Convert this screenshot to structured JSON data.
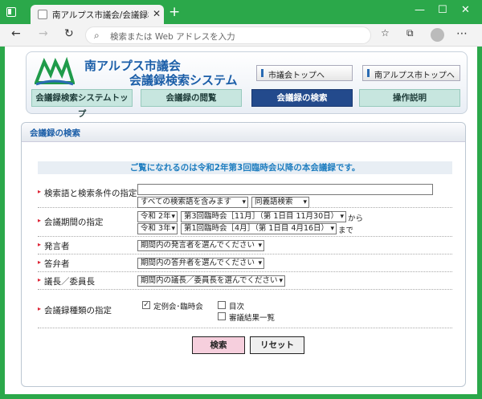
{
  "browser": {
    "tab_title": "南アルプス市議会/会議録検索システム",
    "new_tab": "+",
    "address_placeholder": "検索または Web アドレスを入力",
    "back": "←",
    "forward": "→",
    "refresh": "↻",
    "more": "⋯",
    "minimize": "—",
    "maximize": "☐",
    "close": "✕"
  },
  "header": {
    "site_name_line1": "南アルプス市議会",
    "site_name_line2": "会議録検索システム",
    "link_council_top": "市議会トップへ",
    "link_city_top": "南アルプス市トップへ"
  },
  "nav": {
    "tabs": [
      "会議録検索システムトップ",
      "会議録の閲覧",
      "会議録の検索",
      "操作説明"
    ],
    "active_index": 2
  },
  "search": {
    "section_title": "会議録の検索",
    "notice": "ご覧になれるのは令和2年第3回臨時会以降の本会議録です。",
    "keyword_label": "検索語と検索条件の指定",
    "keyword_value": "",
    "keyword_condition": "すべての検索語を含みます",
    "synonym_option": "同義語検索",
    "period_label": "会議期間の指定",
    "from_year": "令和 2年",
    "from_meeting": "第3回臨時会［11月］（第 1日目 11月30日）",
    "from_suffix": "から",
    "to_year": "令和 3年",
    "to_meeting": "第1回臨時会［4月］（第 1日目 4月16日）",
    "to_suffix": "まで",
    "speaker_label": "発言者",
    "speaker_value": "期間内の発言者を選んでください",
    "answerer_label": "答弁者",
    "answerer_value": "期間内の答弁者を選んでください",
    "chair_label": "議長／委員長",
    "chair_value": "期間内の議長／委員長を選んでください",
    "type_label": "会議録種類の指定",
    "type_options": [
      {
        "label": "定例会･臨時会",
        "checked": true
      },
      {
        "label": "目次",
        "checked": false
      },
      {
        "label": "審議結果一覧",
        "checked": false
      }
    ],
    "search_button": "検索",
    "reset_button": "リセット"
  },
  "colors": {
    "frame": "#2ba84a",
    "nav_active": "#234a8c",
    "nav_inactive": "#c7e6df",
    "search_button": "#f6cfdd"
  }
}
